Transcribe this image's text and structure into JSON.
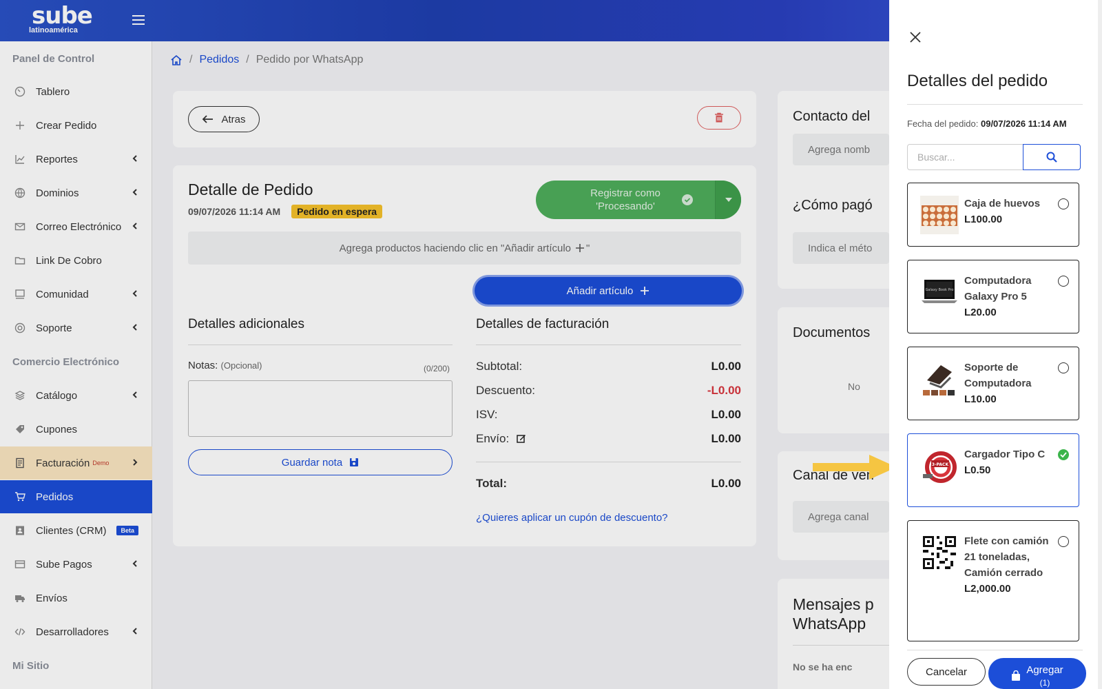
{
  "brand": {
    "name": "sube",
    "sub": "latinoamérica"
  },
  "sidebar": {
    "sections": [
      "Panel de Control",
      "Comercio Electrónico",
      "Mi Sitio"
    ],
    "items": [
      {
        "label": "Tablero",
        "icon": "gauge-icon"
      },
      {
        "label": "Crear Pedido",
        "icon": "plus-icon"
      },
      {
        "label": "Reportes",
        "icon": "chart-line-icon"
      },
      {
        "label": "Dominios",
        "icon": "globe-icon"
      },
      {
        "label": "Correo Electrónico",
        "icon": "envelope-icon"
      },
      {
        "label": "Link De Cobro",
        "icon": "folder-icon"
      },
      {
        "label": "Comunidad",
        "icon": "community-icon"
      },
      {
        "label": "Soporte",
        "icon": "lifebuoy-icon"
      },
      {
        "label": "Catálogo",
        "icon": "layers-icon"
      },
      {
        "label": "Cupones",
        "icon": "tag-icon"
      },
      {
        "label": "Facturación",
        "sup": "Demo",
        "icon": "receipt-icon"
      },
      {
        "label": "Pedidos",
        "icon": "cart-icon"
      },
      {
        "label": "Clientes (CRM)",
        "badge": "Beta",
        "icon": "contact-card-icon"
      },
      {
        "label": "Sube Pagos",
        "icon": "credit-card-icon"
      },
      {
        "label": "Envíos",
        "icon": "truck-icon"
      },
      {
        "label": "Desarrolladores",
        "icon": "code-icon"
      }
    ]
  },
  "breadcrumb": {
    "items": [
      "Pedidos",
      "Pedido por WhatsApp"
    ]
  },
  "toolbar": {
    "back_label": "Atras"
  },
  "order": {
    "title": "Detalle de Pedido",
    "date": "09/07/2026 11:14 AM",
    "status": "Pedido en espera",
    "register_label_1": "Registrar como",
    "register_label_2": "'Procesando'",
    "hint": "Agrega productos haciendo clic en \"Añadir artículo",
    "hint_end": "\"",
    "add_item_label": "Añadir artículo"
  },
  "additional": {
    "title": "Detalles adicionales",
    "notes_label": "Notas:",
    "notes_optional": "(Opcional)",
    "counter": "(0/200)",
    "save_note_label": "Guardar nota"
  },
  "billing": {
    "title": "Detalles de facturación",
    "rows": [
      {
        "label": "Subtotal:",
        "value": "L0.00"
      },
      {
        "label": "Descuento:",
        "value": "-L0.00"
      },
      {
        "label": "ISV:",
        "value": "L0.00"
      },
      {
        "label": "Envío:",
        "value": "L0.00"
      }
    ],
    "total_label": "Total:",
    "total_value": "L0.00",
    "coupon_link": "¿Quieres aplicar un cupón de descuento?"
  },
  "right_column": {
    "contact_title": "Contacto del",
    "contact_input": "Agrega nomb",
    "payment_title": "¿Cómo pagó",
    "payment_input": "Indica el méto",
    "documents_title": "Documentos",
    "documents_text": "No",
    "channel_title": "Canal de ven",
    "channel_input": "Agrega canal",
    "messages_title_1": "Mensajes p",
    "messages_title_2": "WhatsApp",
    "messages_text": "No se ha enc"
  },
  "panel": {
    "title": "Detalles del pedido",
    "date_label": "Fecha del pedido:",
    "date_value": "09/07/2026 11:14 AM",
    "search_placeholder": "Buscar...",
    "products": [
      {
        "name": "Caja de huevos",
        "price": "L100.00",
        "selected": false
      },
      {
        "name": "Computadora Galaxy Pro 5",
        "price": "L20.00",
        "selected": false
      },
      {
        "name": "Soporte de Computadora",
        "price": "L10.00",
        "selected": false
      },
      {
        "name": "Cargador Tipo C",
        "price": "L0.50",
        "selected": true
      },
      {
        "name": "Flete con camión 21 toneladas, Camión cerrado",
        "price": "L2,000.00",
        "selected": false
      }
    ],
    "cancel_label": "Cancelar",
    "add_label": "Agregar",
    "add_count": "(1)"
  },
  "colors": {
    "primary": "#1c4ed8",
    "success": "#4fae5c",
    "warning": "#f6c22b",
    "danger": "#d9363e",
    "highlight": "#f5c542"
  }
}
